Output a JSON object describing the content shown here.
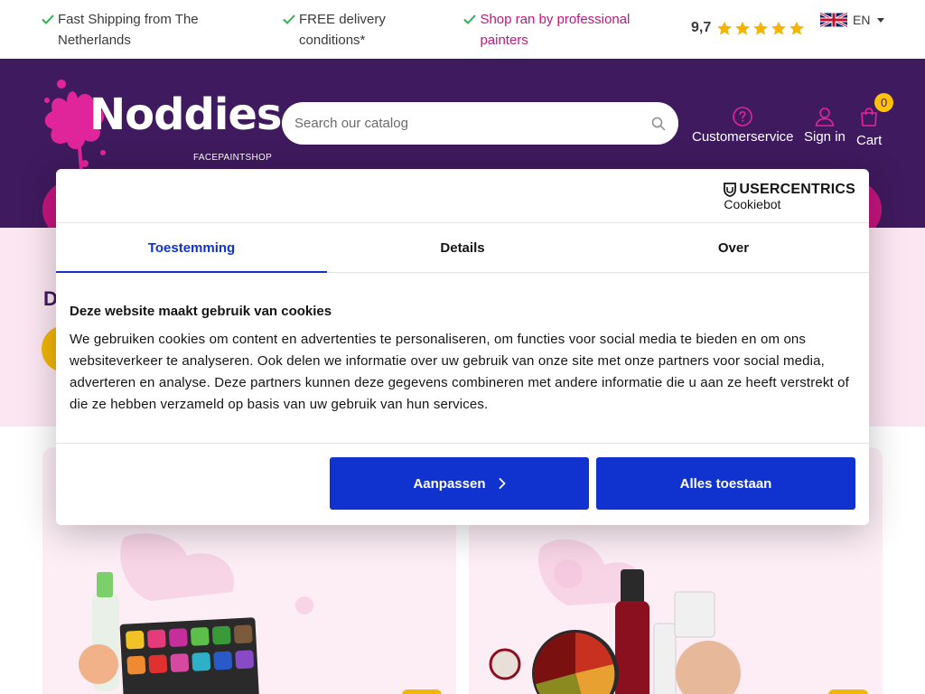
{
  "topbar": {
    "usps": [
      {
        "text": "Fast Shipping from The Netherlands"
      },
      {
        "text": "FREE delivery conditions*"
      },
      {
        "text": "Shop ran by professional painters"
      }
    ],
    "rating": {
      "score": "9,7",
      "stars": 5
    },
    "language": "EN"
  },
  "header": {
    "logo_text": "Noddies",
    "logo_sub": "FACEPAINTSHOP",
    "search_placeholder": "Search our catalog",
    "customerservice": "Customerservice",
    "sign_in": "Sign in",
    "cart": "Cart",
    "cart_count": "0"
  },
  "hero": {
    "title_visible": "D"
  },
  "cookie": {
    "brand_line1": "USERCENTRICS",
    "brand_line2": "Cookiebot",
    "tabs": [
      {
        "label": "Toestemming"
      },
      {
        "label": "Details"
      },
      {
        "label": "Over"
      }
    ],
    "title": "Deze website maakt gebruik van cookies",
    "text": "We gebruiken cookies om content en advertenties te personaliseren, om functies voor social media te bieden en om ons websiteverkeer te analyseren. Ook delen we informatie over uw gebruik van onze site met onze partners voor social media, adverteren en analyse. Deze partners kunnen deze gegevens combineren met andere informatie die u aan ze heeft verstrekt of die ze hebben verzameld op basis van uw gebruik van hun services.",
    "customize_label": "Aanpassen",
    "allow_all_label": "Alles toestaan"
  },
  "colors": {
    "header_bg": "#3f1a5e",
    "brand_pink": "#c4157d",
    "accent_yellow": "#f2b705",
    "cookie_blue": "#1032cf",
    "check_green": "#2bb24c",
    "star_yellow": "#f5b400"
  }
}
